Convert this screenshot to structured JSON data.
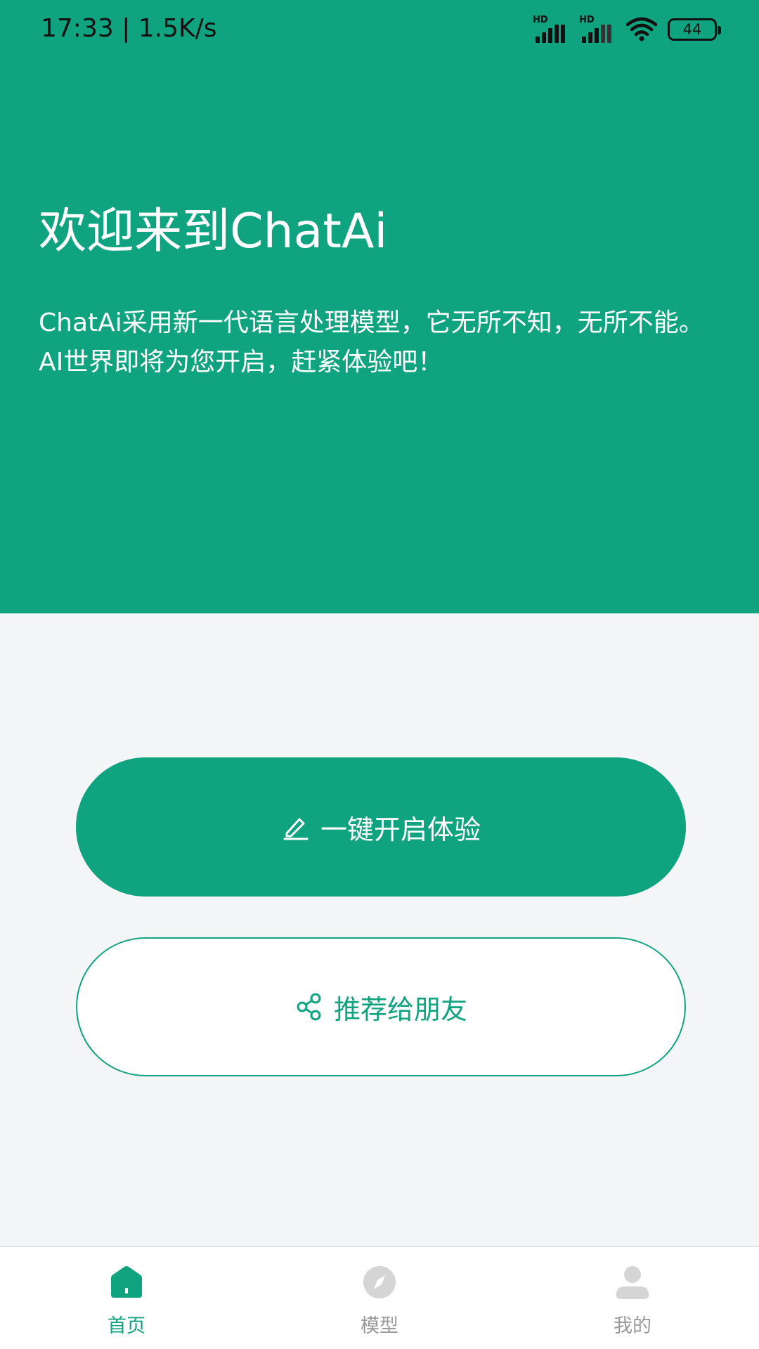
{
  "status_bar": {
    "time_speed": "17:33 | 1.5K/s",
    "signal_1_label": "HD",
    "signal_2_label": "HD",
    "battery_level": "44"
  },
  "hero": {
    "title": "欢迎来到ChatAi",
    "desc_line1": "ChatAi采用新一代语言处理模型，它无所不知，无所不能。",
    "desc_line2": "AI世界即将为您开启，赶紧体验吧！",
    "background_color": "#10a37f"
  },
  "actions": {
    "start_label": "一键开启体验",
    "start_icon": "pencil-icon",
    "share_label": "推荐给朋友",
    "share_icon": "share-icon"
  },
  "bottom_nav": {
    "items": [
      {
        "label": "首页",
        "icon": "home-icon",
        "active": true
      },
      {
        "label": "模型",
        "icon": "compass-icon",
        "active": false
      },
      {
        "label": "我的",
        "icon": "user-icon",
        "active": false
      }
    ]
  },
  "colors": {
    "accent": "#10a37f",
    "page_background": "#f4f5f7",
    "inactive": "#999999"
  }
}
